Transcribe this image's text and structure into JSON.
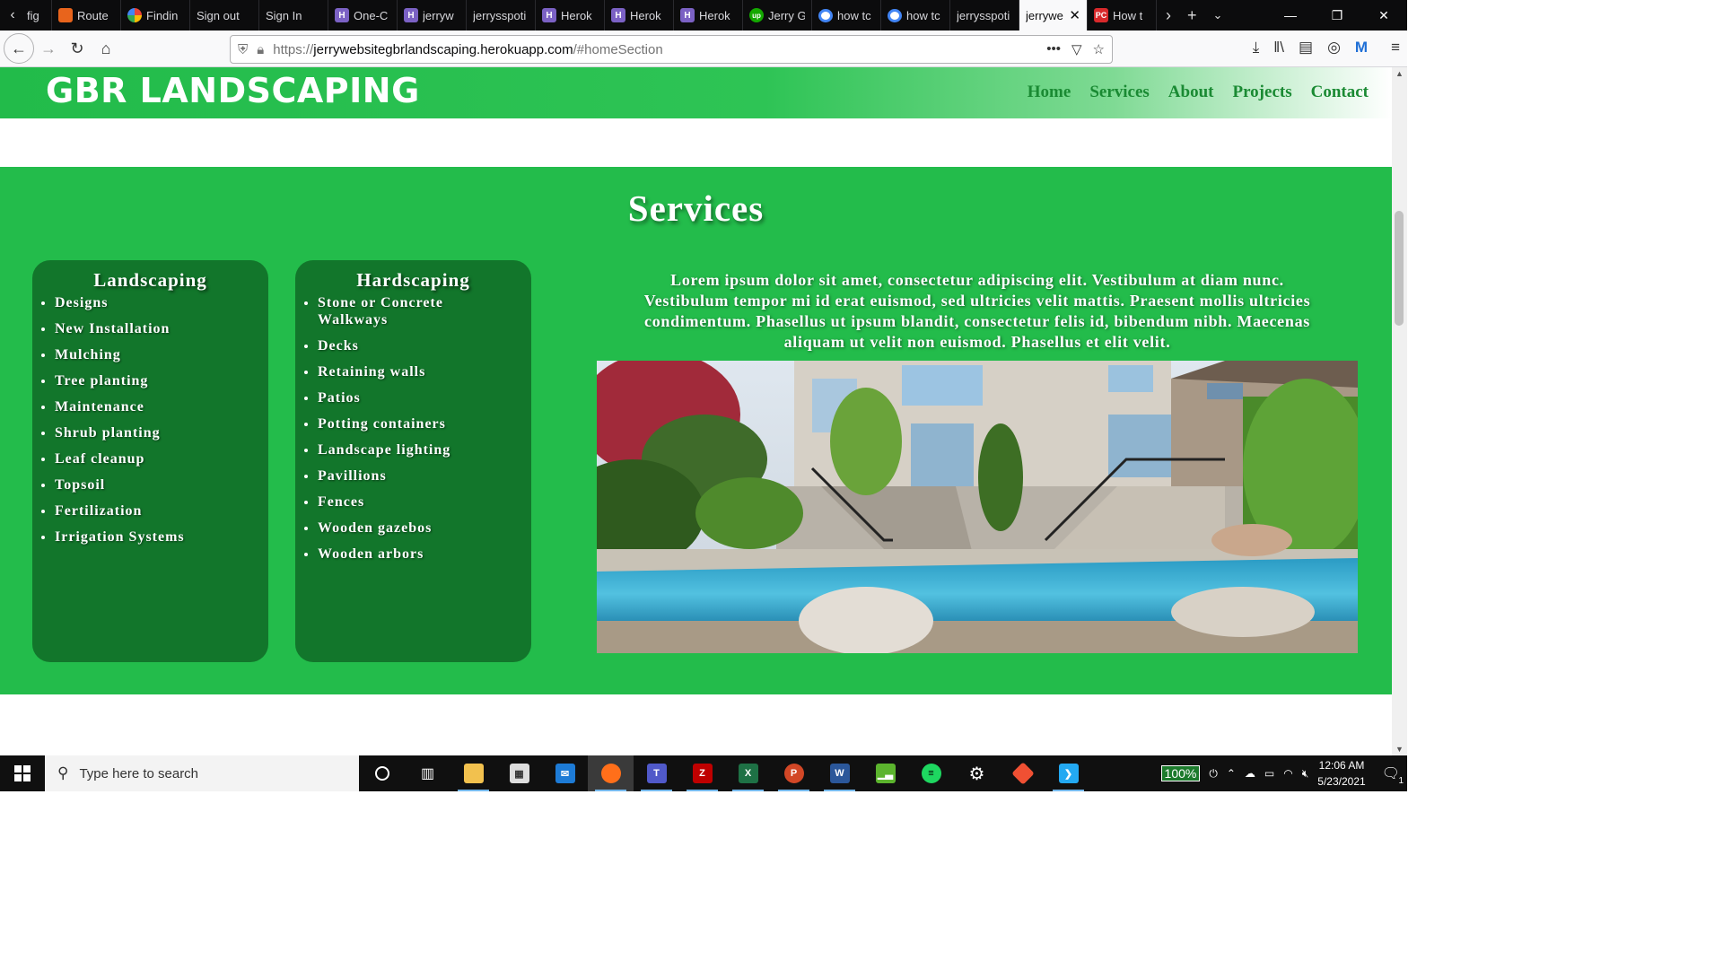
{
  "browser": {
    "tabs": [
      {
        "label": "fig",
        "icon": "none"
      },
      {
        "label": "Route",
        "icon": "route"
      },
      {
        "label": "Findin",
        "icon": "goog2"
      },
      {
        "label": "Sign out",
        "icon": "none"
      },
      {
        "label": "Sign In",
        "icon": "none"
      },
      {
        "label": "One-C",
        "icon": "heroku"
      },
      {
        "label": "jerryw",
        "icon": "heroku"
      },
      {
        "label": "jerrysspoti",
        "icon": "none"
      },
      {
        "label": "Herok",
        "icon": "heroku"
      },
      {
        "label": "Herok",
        "icon": "heroku"
      },
      {
        "label": "Herok",
        "icon": "heroku"
      },
      {
        "label": "Jerry G",
        "icon": "upwork"
      },
      {
        "label": "how tc",
        "icon": "google"
      },
      {
        "label": "how tc",
        "icon": "google"
      },
      {
        "label": "jerrysspoti",
        "icon": "none"
      },
      {
        "label": "jerrywe",
        "icon": "none",
        "active": true
      },
      {
        "label": "How t",
        "icon": "pc"
      }
    ],
    "url_prefix": "https://",
    "url_host": "jerrywebsitegbrlandscaping.herokuapp.com",
    "url_path": "/#homeSection"
  },
  "site": {
    "logo": "GBR LANDSCAPING",
    "nav": [
      "Home",
      "Services",
      "About",
      "Projects",
      "Contact"
    ],
    "services_title": "Services",
    "landscaping": {
      "title": "Landscaping",
      "items": [
        "Designs",
        "New Installation",
        "Mulching",
        "Tree planting",
        "Maintenance",
        "Shrub planting",
        "Leaf cleanup",
        "Topsoil",
        "Fertilization",
        "Irrigation Systems"
      ]
    },
    "hardscaping": {
      "title": "Hardscaping",
      "items": [
        "Stone or Concrete Walkways",
        "Decks",
        "Retaining walls",
        "Patios",
        "Potting containers",
        "Landscape lighting",
        "Pavillions",
        "Fences",
        "Wooden gazebos",
        "Wooden arbors"
      ]
    },
    "lorem": "Lorem ipsum dolor sit amet, consectetur adipiscing elit. Vestibulum at diam nunc. Vestibulum tempor mi id erat euismod, sed ultricies velit mattis. Praesent mollis ultricies condimentum. Phasellus ut ipsum blandit, consectetur felis id, bibendum nibh. Maecenas aliquam ut velit non euismod. Phasellus et elit velit."
  },
  "taskbar": {
    "search_placeholder": "Type here to search",
    "battery": "100%",
    "time": "12:06 AM",
    "date": "5/23/2021",
    "notifications": "1"
  },
  "colors": {
    "green_section": "#23bc4b",
    "card_green": "#12762b",
    "nav_link": "#1a8a33"
  }
}
